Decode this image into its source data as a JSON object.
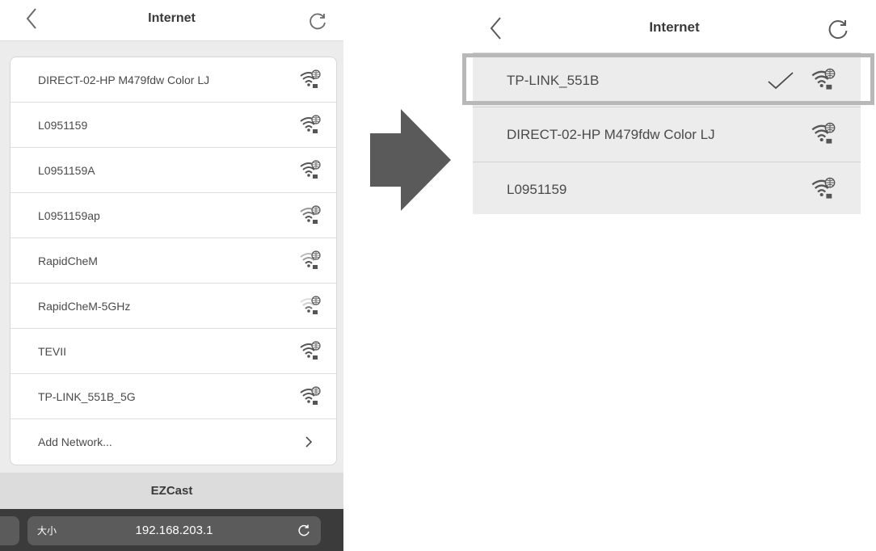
{
  "left_screen": {
    "header": {
      "title": "Internet"
    },
    "networks": [
      {
        "label": "DIRECT-02-HP M479fdw Color LJ"
      },
      {
        "label": "L0951159"
      },
      {
        "label": "L0951159A"
      },
      {
        "label": "L0951159ap"
      },
      {
        "label": "RapidCheM"
      },
      {
        "label": "RapidCheM-5GHz"
      },
      {
        "label": "TEVII"
      },
      {
        "label": "TP-LINK_551B_5G"
      }
    ],
    "add_network_label": "Add Network...",
    "footer_title": "EZCast",
    "url_bar": {
      "text_size_label": "大小",
      "url": "192.168.203.1"
    }
  },
  "right_screen": {
    "header": {
      "title": "Internet"
    },
    "networks": [
      {
        "label": "TP-LINK_551B",
        "connected": true
      },
      {
        "label": "DIRECT-02-HP M479fdw Color LJ",
        "connected": false
      },
      {
        "label": "L0951159",
        "connected": false
      }
    ]
  },
  "icons": {
    "back": "chevron-left-icon",
    "refresh": "refresh-icon",
    "wifi": "wifi-locked-icon",
    "check": "checkmark-icon",
    "chevron": "chevron-right-icon",
    "reload": "reload-icon",
    "arrow": "arrow-right-icon"
  },
  "colors": {
    "list_background": "#ececec",
    "url_bar_background": "#3b3b3b",
    "highlight_border": "#b8b8b8",
    "arrow": "#5a5a5a"
  }
}
